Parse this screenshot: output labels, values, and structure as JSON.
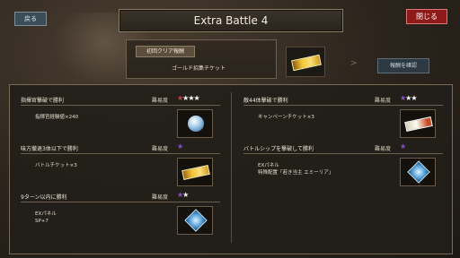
{
  "header": {
    "back_label": "戻る",
    "title": "Extra Battle 4",
    "close_label": "閉じる"
  },
  "first_clear": {
    "tag": "初回クリア報酬",
    "reward_name": "ゴールド招集チケット",
    "icon": "gold-ticket-icon",
    "detail_label": "報酬を確認",
    "arrow": ">"
  },
  "missions_left": [
    {
      "title": "指揮官撃破で勝利",
      "difficulty_label": "難易度",
      "stars": {
        "colored": 1,
        "filled": 3,
        "color": "#c0403b"
      },
      "reward_lines": [
        "指揮官経験値×240"
      ],
      "icon": "exp-orb-icon"
    },
    {
      "title": "味方撤退3体以下で勝利",
      "difficulty_label": "難易度",
      "stars": {
        "colored": 1,
        "filled": 0,
        "color": "#8a4fd0"
      },
      "reward_lines": [
        "バトルチケット×3"
      ],
      "icon": "gold-ticket-icon"
    },
    {
      "title": "9ターン以内に勝利",
      "difficulty_label": "難易度",
      "stars": {
        "colored": 1,
        "filled": 1,
        "color": "#8a4fd0"
      },
      "reward_lines": [
        "EXパネル",
        "SP+7"
      ],
      "icon": "ex-panel-icon"
    }
  ],
  "missions_right": [
    {
      "title": "敵44体撃破で勝利",
      "difficulty_label": "難易度",
      "stars": {
        "colored": 1,
        "filled": 2,
        "color": "#8a4fd0"
      },
      "reward_lines": [
        "キャンペーンチケット×3"
      ],
      "icon": "campaign-ticket-icon"
    },
    {
      "title": "バトルシップを撃破して勝利",
      "difficulty_label": "難易度",
      "stars": {
        "colored": 1,
        "filled": 0,
        "color": "#8a4fd0"
      },
      "reward_lines": [
        "EXパネル",
        "特殊配置「若き当主 エミーリア」"
      ],
      "icon": "ex-panel-icon"
    }
  ]
}
